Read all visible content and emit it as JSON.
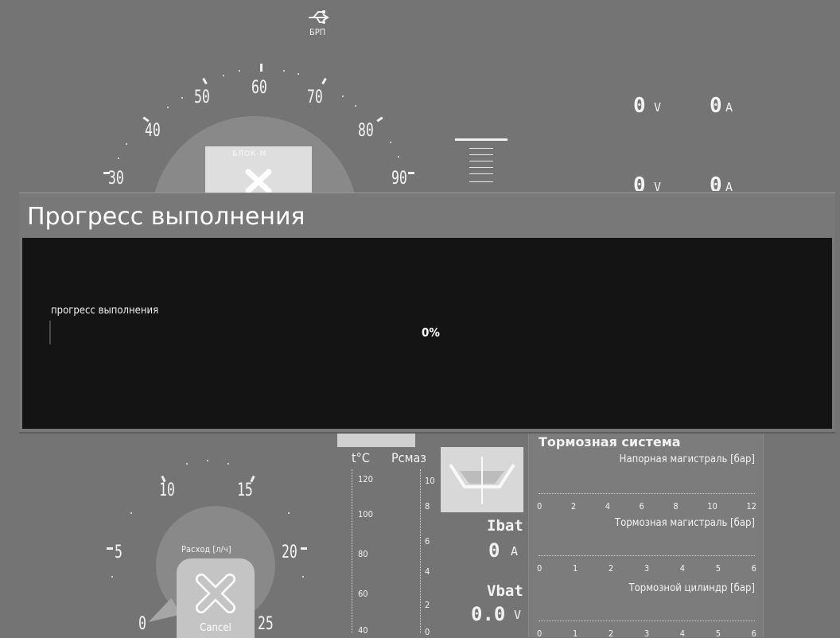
{
  "top": {
    "usb_label": "БРП"
  },
  "speedo": {
    "labels": [
      "30",
      "40",
      "50",
      "60",
      "70",
      "80",
      "90"
    ],
    "module_label": "БЛОК-М"
  },
  "electric": {
    "row1": {
      "volt_value": "0",
      "volt_unit": "V",
      "amp_value": "0",
      "amp_unit": "A"
    },
    "row2": {
      "volt_value": "0",
      "volt_unit": "V",
      "amp_value": "0",
      "amp_unit": "A"
    }
  },
  "dialog": {
    "title": "Прогресс выполнения",
    "status_label": "прогресс выполнения",
    "percent_text": "0%",
    "progress": 0
  },
  "fuel": {
    "labels": [
      "5",
      "10",
      "15",
      "20",
      "25",
      "0"
    ],
    "label": "Расход [л/ч]",
    "cancel_label": "Cancel"
  },
  "thermo": {
    "temp_label": "t°C",
    "temp_ticks": [
      "120",
      "100",
      "80",
      "60",
      "40"
    ],
    "press_label": "Рсмаз",
    "press_ticks": [
      "10",
      "8",
      "6",
      "4",
      "2",
      "0"
    ]
  },
  "battery": {
    "ibat_label": "Ibat",
    "ibat_value": "0",
    "ibat_unit": "A",
    "vbat_label": "Vbat",
    "vbat_value": "0.0",
    "vbat_unit": "V"
  },
  "brake": {
    "title": "Тормозная система",
    "gauges": [
      {
        "label": "Напорная магистраль [бар]",
        "ticks": [
          "0",
          "2",
          "4",
          "6",
          "8",
          "10",
          "12"
        ]
      },
      {
        "label": "Тормозная магистраль [бар]",
        "ticks": [
          "0",
          "1",
          "2",
          "3",
          "4",
          "5",
          "6"
        ]
      },
      {
        "label": "Тормозной цилиндр [бар]",
        "ticks": [
          "0",
          "1",
          "2",
          "3",
          "4",
          "5",
          "6"
        ]
      }
    ]
  }
}
